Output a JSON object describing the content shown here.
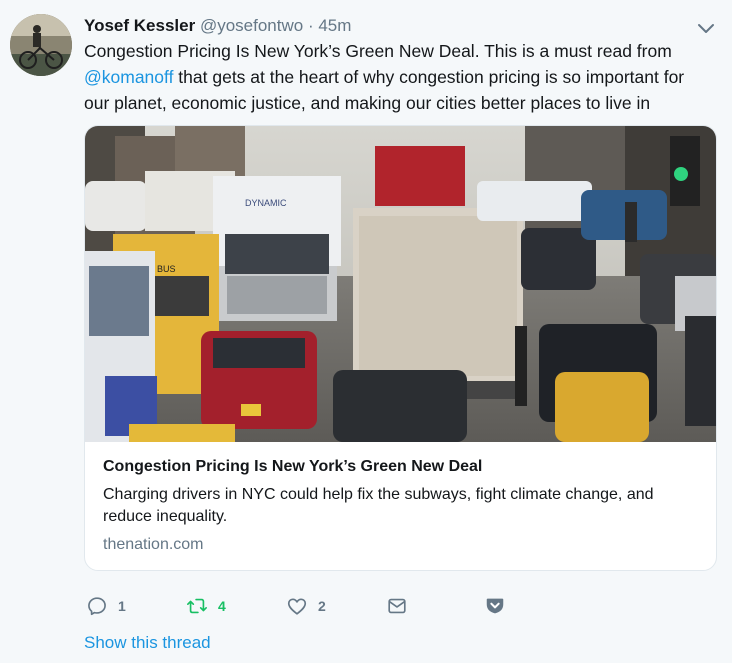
{
  "tweet": {
    "name": "Yosef Kessler",
    "handle": "@yosefontwo",
    "separator": "·",
    "time": "45m",
    "text_before": "Congestion Pricing Is New York’s Green New Deal. This is a must read from ",
    "mention": "@komanoff",
    "text_after": " that gets at the heart of why congestion pricing is so important for our planet, economic justice, and making our cities better places to live in"
  },
  "card": {
    "title": "Congestion Pricing Is New York’s Green New Deal",
    "description": "Charging drivers in NYC could help fix the subways, fight climate change, and reduce inequality.",
    "domain": "thenation.com",
    "truck_label": "DYNAMIC",
    "bus_label": "BUS"
  },
  "actions": {
    "reply_count": "1",
    "retweet_count": "4",
    "like_count": "2"
  },
  "show_thread": "Show this thread",
  "colors": {
    "link": "#1b95e0",
    "retweet": "#17bf63",
    "muted": "#657786",
    "background": "#f5f8fa"
  },
  "icons": [
    "reply-icon",
    "retweet-icon",
    "heart-icon",
    "message-icon",
    "pocket-icon",
    "chevron-down-icon"
  ]
}
